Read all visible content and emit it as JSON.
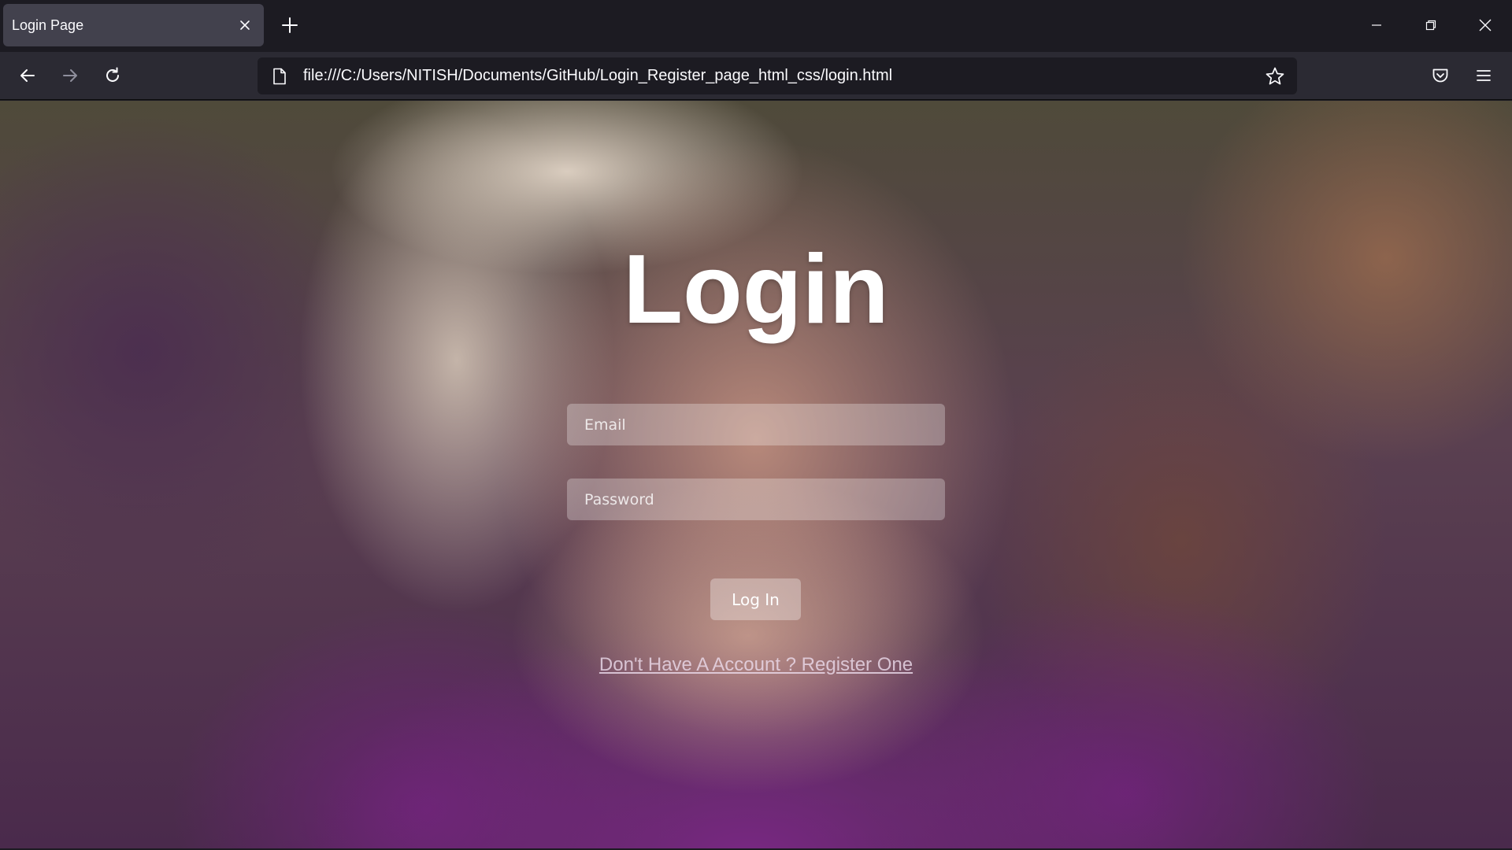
{
  "browser": {
    "tab": {
      "title": "Login Page"
    },
    "url": "file:///C:/Users/NITISH/Documents/GitHub/Login_Register_page_html_css/login.html"
  },
  "page": {
    "title": "Login",
    "email_placeholder": "Email",
    "password_placeholder": "Password",
    "login_button": "Log In",
    "register_link": "Don't Have A Account ? Register One"
  },
  "colors": {
    "tab_strip": "#1c1b22",
    "tab_active": "#42414d",
    "nav_bar": "#2b2a33",
    "url_bar": "#1c1b22",
    "text": "#fbfbfe"
  },
  "icons": {
    "tab_close": "close-icon",
    "new_tab": "plus-icon",
    "minimize": "minimize-icon",
    "restore": "restore-icon",
    "close_window": "close-icon",
    "back": "arrow-left-icon",
    "forward": "arrow-right-icon",
    "reload": "reload-icon",
    "page": "page-icon",
    "bookmark": "star-icon",
    "pocket": "pocket-icon",
    "menu": "hamburger-menu-icon"
  }
}
